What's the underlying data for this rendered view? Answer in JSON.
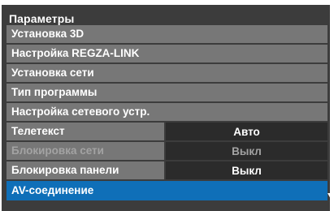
{
  "title": "Параметры",
  "menu": {
    "items": [
      {
        "label": "Установка 3D"
      },
      {
        "label": "Настройка REGZA-LINK"
      },
      {
        "label": "Установка сети"
      },
      {
        "label": "Тип программы"
      },
      {
        "label": "Настройка сетевого устр."
      },
      {
        "label": "Телетекст",
        "value": "Авто"
      },
      {
        "label": "Блокировка сети",
        "value": "Выкл"
      },
      {
        "label": "Блокировка панели",
        "value": "Выкл"
      },
      {
        "label": "AV-соединение"
      }
    ]
  },
  "colors": {
    "panel": "#3c3c3c",
    "row": "#777777",
    "value_box": "#2b2b2b",
    "selected": "#0f6fb8",
    "disabled_text": "#a3a3a3"
  },
  "icons": {
    "scroll": "chevron-down-icon"
  }
}
